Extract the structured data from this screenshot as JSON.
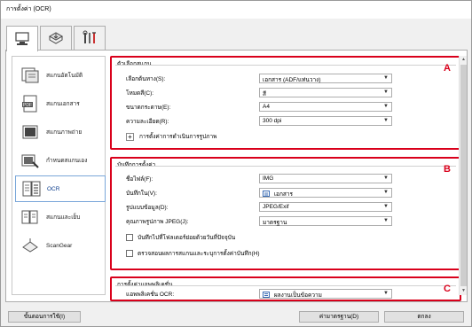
{
  "window": {
    "title": "การตั้งค่า (OCR)"
  },
  "tabs": [
    {
      "icon": "scan-computer-icon",
      "active": true
    },
    {
      "icon": "scanner-tray-icon",
      "active": false
    },
    {
      "icon": "tools-icon",
      "active": false
    }
  ],
  "sidebar": {
    "items": [
      {
        "label": "สแกนอัตโนมัติ",
        "icon": "auto-scan-icon"
      },
      {
        "label": "สแกนเอกสาร",
        "icon": "pdf-document-icon"
      },
      {
        "label": "สแกนภาพถ่าย",
        "icon": "photo-icon"
      },
      {
        "label": "กำหนดสแกนเอง",
        "icon": "custom-scan-icon"
      },
      {
        "label": "OCR",
        "icon": "ocr-icon",
        "active": true
      },
      {
        "label": "สแกนและเย็บ",
        "icon": "stitch-icon"
      },
      {
        "label": "ScanGear",
        "icon": "scangear-icon"
      }
    ]
  },
  "sectionA": {
    "legend": "ตัวเลือกสแกน",
    "marker": "A",
    "rows": [
      {
        "label": "เลือกต้นทาง(S):",
        "value": "เอกสาร (ADF/แท่นวาง)"
      },
      {
        "label": "โหมดสี(C):",
        "value": "สี"
      },
      {
        "label": "ขนาดกระดาษ(E):",
        "value": "A4"
      },
      {
        "label": "ความละเอียด(R):",
        "value": "300 dpi"
      }
    ],
    "expand_label": "การตั้งค่าการดำเนินการรูปภาพ"
  },
  "sectionB": {
    "legend": "บันทึกการตั้งค่า",
    "marker": "B",
    "rows": [
      {
        "label": "ชื่อไฟล์(F):",
        "value": "IMG"
      },
      {
        "label": "บันทึกใน(V):",
        "value": "เอกสาร"
      },
      {
        "label": "รูปแบบข้อมูล(D):",
        "value": "JPEG/Exif"
      },
      {
        "label": "คุณภาพรูปภาพ JPEG(J):",
        "value": "มาตรฐาน"
      }
    ],
    "check1": "บันทึกไปที่โฟลเดอร์ย่อยด้วยวันที่ปัจจุบัน",
    "check2": "ตรวจสอบผลการสแกนและระบุการตั้งค่าบันทึก(H)"
  },
  "sectionC": {
    "legend": "การตั้งค่าแอพพลิเคชั่น",
    "marker": "C",
    "row": {
      "label": "แอพพลิเคชั่น OCR:",
      "value": "ผลงานเป็นข้อความ"
    }
  },
  "buttons": {
    "instructions": "ขั้นตอนการใช้(I)",
    "defaults": "ค่ามาตรฐาน(D)",
    "ok": "ตกลง"
  },
  "colors": {
    "highlight": "#d9001b",
    "accent": "#0a3c8c"
  }
}
